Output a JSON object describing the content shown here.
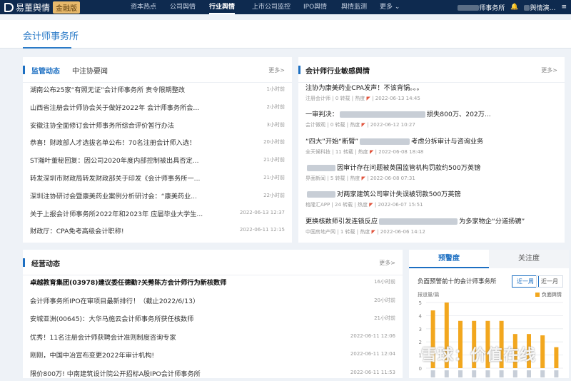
{
  "brand": {
    "name": "易董舆情",
    "badge": "金融版"
  },
  "nav": [
    {
      "label": "资本热点"
    },
    {
      "label": "公司舆情"
    },
    {
      "label": "行业舆情"
    },
    {
      "label": "上市公司监控"
    },
    {
      "label": "IPO舆情"
    },
    {
      "label": "舆情监测"
    },
    {
      "label": "更多"
    }
  ],
  "user": {
    "org": "师事务所",
    "name": "舆情演"
  },
  "page": {
    "title": "会计师事务所"
  },
  "supervision": {
    "tabs": [
      "监管动态",
      "中注协要闻"
    ],
    "more": "更多>",
    "items": [
      {
        "title": "湖南公布25家“有照无证”会计师事务所 责令限期整改",
        "date": "1小时前"
      },
      {
        "title": "山西省注册会计师协会关于做好2022年 会计师事务所会...",
        "date": "2小时前"
      },
      {
        "title": "安徽注协全面修订会计师事务所综合评价暂行办法",
        "date": "3小时前"
      },
      {
        "title": "恭喜！财政部人才选拔名单公布！70名注册会计师入选！",
        "date": "20小时前"
      },
      {
        "title": "ST瀚叶董秘回复：因公司2020年度内部控制被出具否定...",
        "date": "21小时前"
      },
      {
        "title": "转发深圳市财政局转发财政部关于印发《会计师事务所一...",
        "date": "21小时前"
      },
      {
        "title": "深圳注协研讨会暨康美药业案例分析研讨会：“康美药业...",
        "date": "22小时前"
      },
      {
        "title": "关于上报会计师事务所2022年和2023年 应届毕业大学生...",
        "date": "2022-06-13 12:37"
      },
      {
        "title": "财政厅：CPA免考高级会计职称!",
        "date": "2022-06-11 12:15"
      }
    ]
  },
  "sensitive": {
    "title": "会计师行业敏感舆情",
    "more": "更多>",
    "items": [
      {
        "title": "注协为康美药业CPA发声！不该背锅。。。",
        "source": "注册会计师",
        "count": "0 转载",
        "heat": "热度",
        "date": "2022-06-13 14:45"
      },
      {
        "title": "一审判决：",
        "tail": "损失800万、202万...",
        "source": "会计微观",
        "count": "0 转载",
        "heat": "热度",
        "date": "2022-06-12 10:27"
      },
      {
        "title": "“四大”开始“断臂”",
        "tail": "考虑分拆审计与咨询业务",
        "source": "全天候科技",
        "count": "11 转载",
        "heat": "热度",
        "date": "2022-06-08 18:48"
      },
      {
        "title": "",
        "tail": "因审计存在问题被英国监管机构罚款约500万英镑",
        "source": "界面新闻",
        "count": "5 转载",
        "heat": "热度",
        "date": "2022-06-08 07:31"
      },
      {
        "title": "",
        "tail": "对两家建筑公司审计失误被罚款500万英镑",
        "source": "格隆汇APP",
        "count": "24 转载",
        "heat": "热度",
        "date": "2022-06-07 15:51"
      },
      {
        "title": "更换核数师引发连锁反应",
        "tail": "为多家物企“分道扬镳”",
        "source": "中国房地产网",
        "count": "1 转载",
        "heat": "热度",
        "date": "2022-06-06 14:12"
      }
    ]
  },
  "business": {
    "title": "经营动态",
    "more": "更多>",
    "items": [
      {
        "title": "卓越教育集团(03978)建议委任德勤?关莠陈方会计师行为新核数师",
        "date": "16小时前",
        "bold": true
      },
      {
        "title": "会计师事务所IPO在审项目最新排行！（截止2022/6/13）",
        "date": "20小时前"
      },
      {
        "title": "安城亚洲(00645)：大华马施云会计师事务所获任核数师",
        "date": "21小时前"
      },
      {
        "title": "优秀！11名注册会计师获聘会计准则制度咨询专家",
        "date": "2022-06-11 12:06"
      },
      {
        "title": "刚刚，中国中冶宣布变更2022年审计机构!",
        "date": "2022-06-11 12:04"
      },
      {
        "title": "限价800万! 中南建筑设计院公开招标A股IPO会计师事务所",
        "date": "2022-06-11 11:53"
      }
    ]
  },
  "warning": {
    "tabs": [
      "预警度",
      "关注度"
    ],
    "chart_title": "负面预警前十的会计师事务所",
    "periods": [
      "近一周",
      "近一月"
    ],
    "ylabel": "报道量/篇",
    "legend": "负面舆情"
  },
  "chart_data": {
    "type": "bar",
    "series": [
      {
        "name": "负面舆情",
        "values": [
          4.4,
          5,
          3.6,
          3.6,
          3.6,
          3.6,
          2.6,
          2.6,
          2.5,
          1.6
        ]
      }
    ],
    "categories": [
      "",
      "",
      "",
      "",
      "",
      "",
      "",
      "",
      "",
      ""
    ],
    "ylim": [
      0,
      5
    ],
    "yticks": [
      0,
      1,
      2,
      3,
      4,
      5
    ],
    "color": "#f2a71e",
    "grid": true
  },
  "watermark": "雪球：价值在线"
}
